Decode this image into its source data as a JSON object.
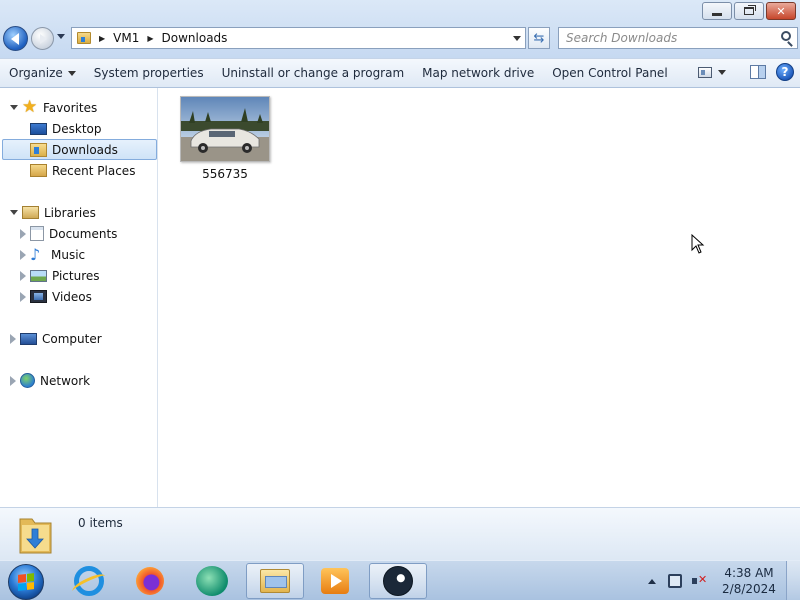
{
  "window": {
    "buttons": {
      "minimize": "minimize",
      "maximize": "maximize",
      "close": "close"
    }
  },
  "address": {
    "crumbs": [
      "VM1",
      "Downloads"
    ]
  },
  "search": {
    "placeholder": "Search Downloads"
  },
  "toolbar": {
    "organize": "Organize",
    "system_properties": "System properties",
    "uninstall": "Uninstall or change a program",
    "map_drive": "Map network drive",
    "control_panel": "Open Control Panel",
    "help": "?"
  },
  "nav": {
    "favorites": "Favorites",
    "desktop": "Desktop",
    "downloads": "Downloads",
    "recent_places": "Recent Places",
    "libraries": "Libraries",
    "documents": "Documents",
    "music": "Music",
    "pictures": "Pictures",
    "videos": "Videos",
    "computer": "Computer",
    "network": "Network"
  },
  "files": [
    {
      "name": "556735",
      "icon": "car-photo-thumbnail"
    }
  ],
  "details": {
    "count": "0 items"
  },
  "taskbar": {
    "apps": [
      "internet-explorer",
      "firefox",
      "swift-app",
      "windows-explorer",
      "media-player",
      "steam"
    ],
    "active_app": "windows-explorer"
  },
  "clock": {
    "time": "4:38 AM",
    "date": "2/8/2024"
  },
  "colors": {
    "accent": "#1e5fbf",
    "selection": "#cfe3f8",
    "taskbar": "#a9c2e0"
  }
}
